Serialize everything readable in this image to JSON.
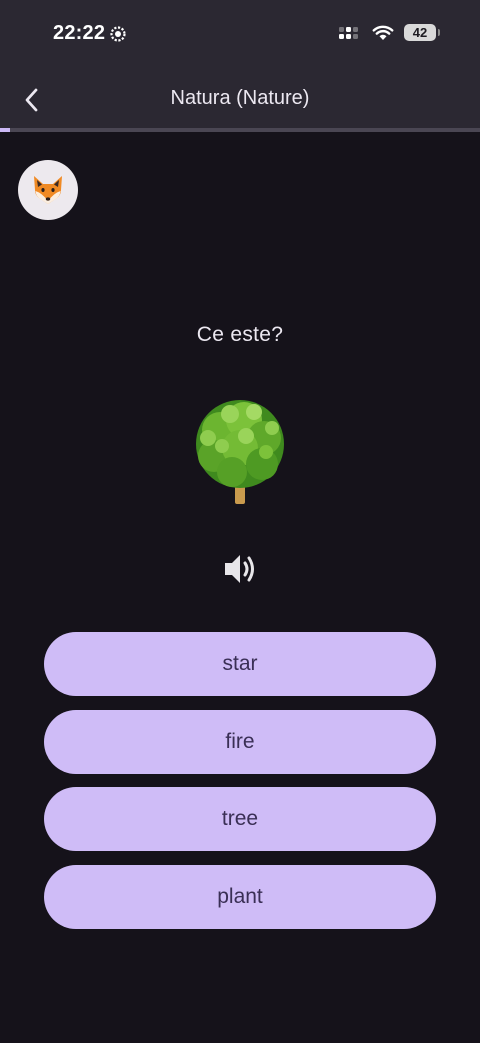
{
  "status_bar": {
    "time": "22:22",
    "battery": "42"
  },
  "header": {
    "title": "Natura (Nature)"
  },
  "progress": {
    "fraction": 0.02
  },
  "question": {
    "prompt": "Ce este?",
    "picture": "tree-icon"
  },
  "options": [
    {
      "label": "star"
    },
    {
      "label": "fire"
    },
    {
      "label": "tree"
    },
    {
      "label": "plant"
    }
  ],
  "colors": {
    "background": "#15121a",
    "header": "#2b2832",
    "accent": "#cfbcf7",
    "option_text": "#3a2f55"
  },
  "icons": {
    "avatar": "fox-icon",
    "back": "chevron-left-icon",
    "audio": "speaker-icon"
  }
}
